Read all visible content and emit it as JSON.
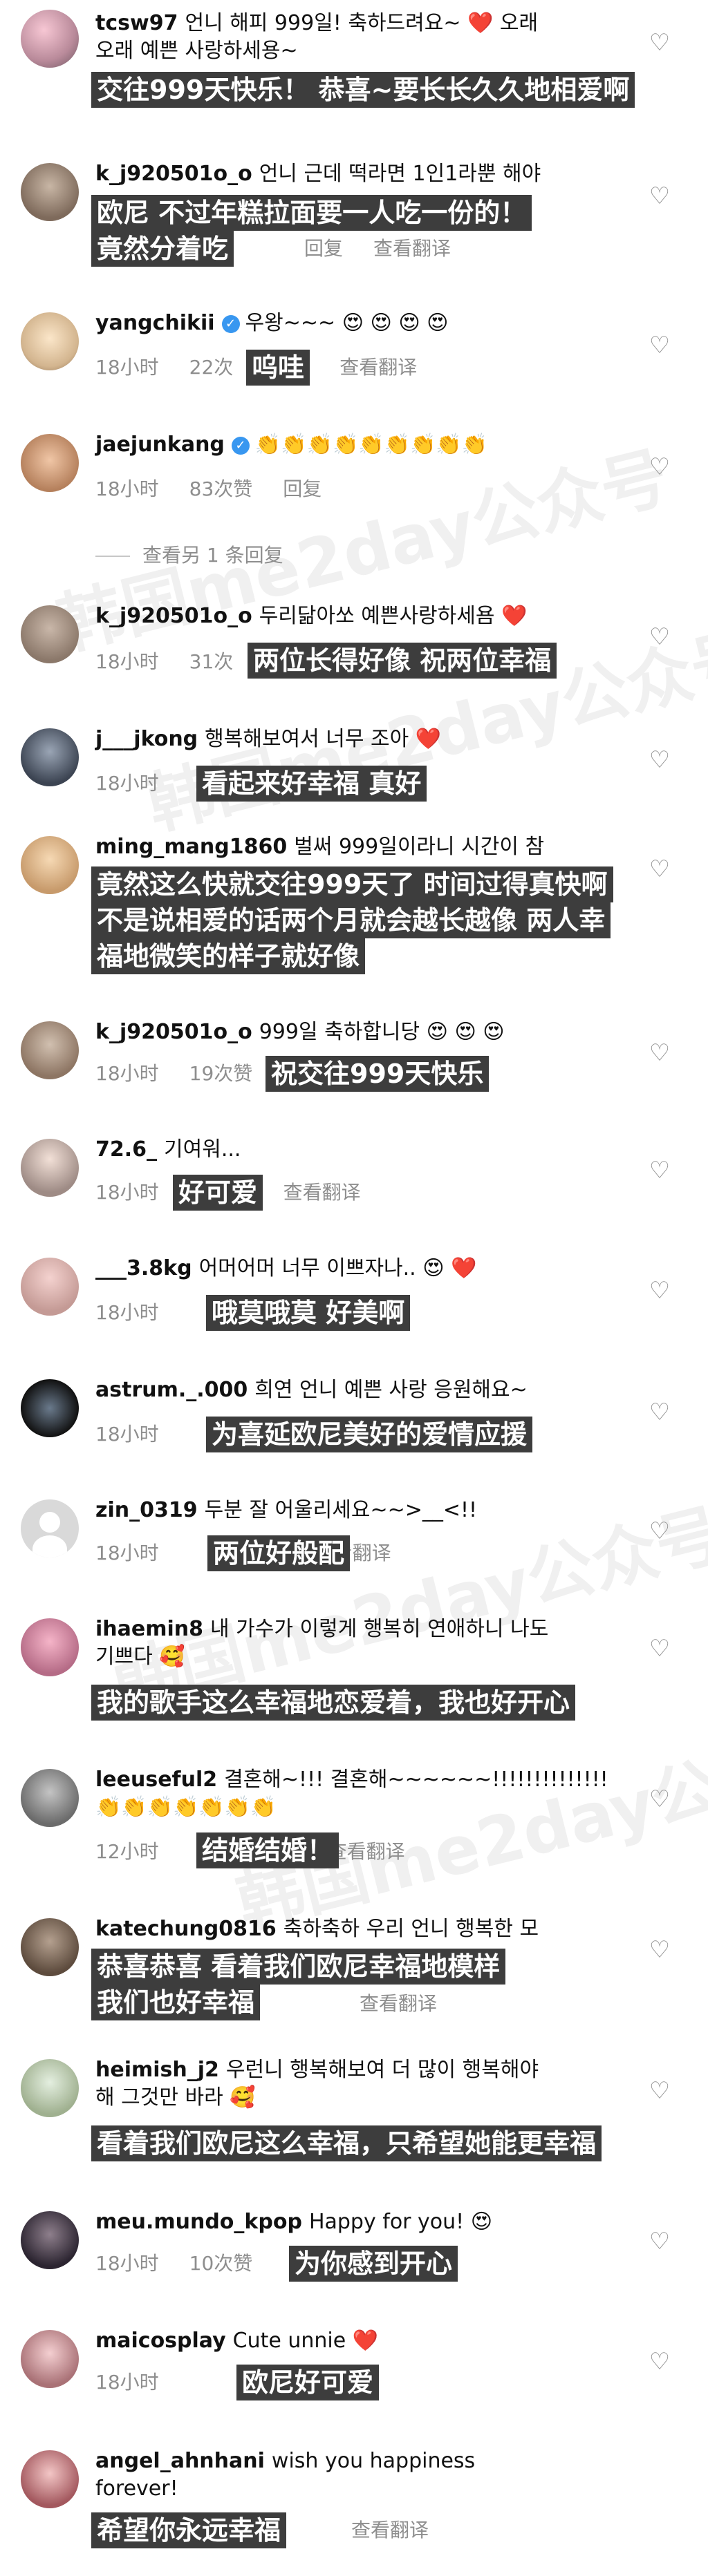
{
  "watermark": "韩国me2day公众号",
  "comments": [
    {
      "username": "tcsw97",
      "text": "언니 해피 999일! 축하드려요~ ❤️ 오래",
      "text2": "오래 예쁜 사랑하세용~",
      "sub": "交往999天快乐！ 恭喜~要长长久久地相爱啊"
    },
    {
      "username": "k_j920501o_o",
      "text": "언니 근데 떡라면 1인1라뿐 해야",
      "sub": "欧尼 不过年糕拉面要一人吃一份的！",
      "sub2": "竟然分着吃",
      "meta_reply": "回复",
      "meta_translate": "查看翻译"
    },
    {
      "username": "yangchikii",
      "text": "우왕~~~ 😍 😍 😍 😍",
      "meta_time": "18小时",
      "meta_likes": "22次",
      "sub": "呜哇",
      "meta_translate": "查看翻译"
    },
    {
      "username": "jaejunkang",
      "text": "👏👏👏👏👏👏👏👏👏",
      "meta_time": "18小时",
      "meta_likes": "83次赞",
      "meta_reply": "回复",
      "view_replies": "查看另 1 条回复"
    },
    {
      "username": "k_j920501o_o",
      "text": "두리닮아쏘 예쁜사랑하세욤 ❤️",
      "meta_time": "18小时",
      "meta_likes": "31次",
      "sub": "两位长得好像 祝两位幸福"
    },
    {
      "username": "j___jkong",
      "text": "행복해보여서 너무 조아 ❤️",
      "meta_time": "18小时",
      "sub": "看起来好幸福 真好"
    },
    {
      "username": "ming_mang1860",
      "text": "벌써 999일이라니 시간이 참",
      "sub": "竟然这么快就交往999天了 时间过得真快啊",
      "sub2": "不是说相爱的话两个月就会越长越像 两人幸",
      "sub3": "福地微笑的样子就好像"
    },
    {
      "username": "k_j920501o_o",
      "text": "999일 축하합니당 😍 😍 😍",
      "meta_time": "18小时",
      "meta_likes": "19次赞",
      "sub": "祝交往999天快乐"
    },
    {
      "username": "72.6_",
      "text": "기여워...",
      "meta_time": "18小时",
      "sub": "好可爱",
      "meta_translate": "查看翻译"
    },
    {
      "username": "___3.8kg",
      "text": "어머어머 너무 이쁘자나.. 😍 ❤️",
      "meta_time": "18小时",
      "sub": "哦莫哦莫 好美啊"
    },
    {
      "username": "astrum._.000",
      "text": "희연 언니 예쁜 사랑 응원해요~",
      "meta_time": "18小时",
      "sub": "为喜延欧尼美好的爱情应援"
    },
    {
      "username": "zin_0319",
      "text": "두분 잘 어울리세요~~>__<!!",
      "meta_time": "18小时",
      "sub": "两位好般配",
      "meta_translate": "查看翻译"
    },
    {
      "username": "ihaemin8",
      "text": "내 가수가 이렇게 행복히 연애하니 나도",
      "text2": "기쁘다 🥰",
      "sub": "我的歌手这么幸福地恋爱着，我也好开心"
    },
    {
      "username": "leeuseful2",
      "text": "결혼해~!!! 결혼해~~~~~~!!!!!!!!!!!!!!",
      "text2": "👏👏👏👏👏👏👏",
      "meta_time": "12小时",
      "sub": "结婚结婚！",
      "meta_translate": "查看翻译"
    },
    {
      "username": "katechung0816",
      "text": "축하축하 우리 언니 행복한 모",
      "sub": "恭喜恭喜 看着我们欧尼幸福地模样",
      "sub2": "我们也好幸福",
      "meta_time": "18小时",
      "meta_translate": "查看翻译"
    },
    {
      "username": "heimish_j2",
      "text": "우런니 행복해보여 더 많이 행복해야",
      "text2": "해 그것만 바라 🥰",
      "sub": "看着我们欧尼这么幸福，只希望她能更幸福"
    },
    {
      "username": "meu.mundo_kpop",
      "text": "Happy for you! 😍",
      "meta_time": "18小时",
      "meta_likes": "10次赞",
      "sub": "为你感到开心"
    },
    {
      "username": "maicosplay",
      "text": "Cute unnie ❤️",
      "meta_time": "18小时",
      "sub": "欧尼好可爱"
    },
    {
      "username": "angel_ahnhani",
      "text": "wish you happiness",
      "text2": "forever!",
      "sub": "希望你永远幸福",
      "meta_translate": "查看翻译"
    }
  ]
}
